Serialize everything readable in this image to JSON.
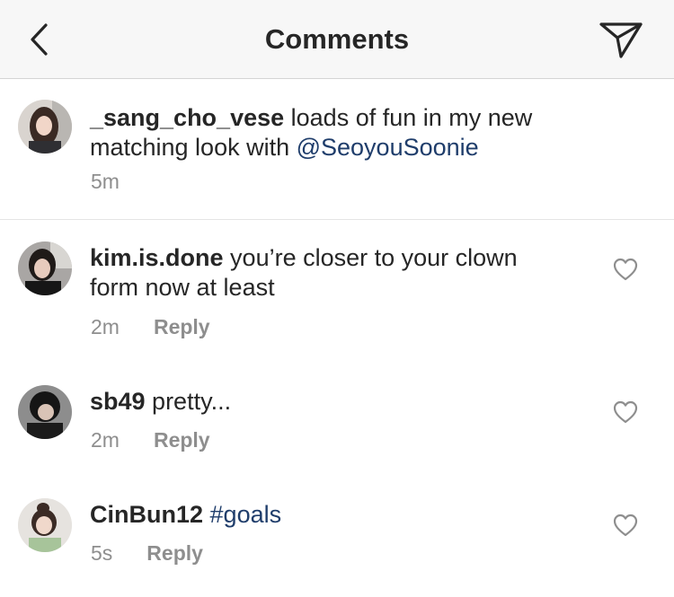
{
  "header": {
    "title": "Comments",
    "back_icon": "chevron-left-icon",
    "send_icon": "paper-plane-icon"
  },
  "caption": {
    "username": "_sang_cho_vese",
    "text_line1": " loads of fun in my new",
    "text_line2": "matching look with ",
    "mention": "@SeoyouSoonie",
    "time": "5m"
  },
  "comments": [
    {
      "username": "kim.is.done",
      "text_line1": " you’re closer to your clown",
      "text_line2": "form now at least",
      "time": "2m",
      "reply_label": "Reply"
    },
    {
      "username": "sb49",
      "text_line1": " pretty...",
      "time": "2m",
      "reply_label": "Reply"
    },
    {
      "username": "CinBun12",
      "text_line1": " ",
      "hashtag": "#goals",
      "time": "5s",
      "reply_label": "Reply"
    }
  ],
  "colors": {
    "text": "#262626",
    "secondary": "#8e8e8e",
    "link": "#1f3d6b",
    "header_bg": "#f7f7f7"
  }
}
